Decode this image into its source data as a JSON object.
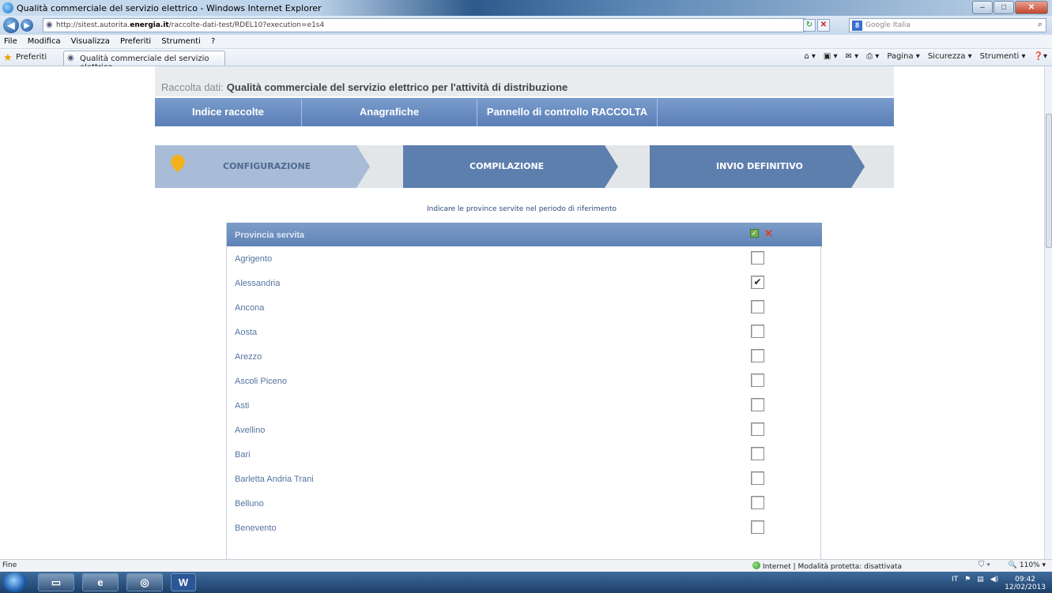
{
  "window": {
    "title": "Qualità commerciale del servizio elettrico - Windows Internet Explorer"
  },
  "address_bar": {
    "url_prefix": "http://sitest.autorita.",
    "url_domain": "energia.it",
    "url_suffix": "/raccolte-dati-test/RDEL10?execution=e1s4",
    "search_placeholder": "Google Italia"
  },
  "menu": [
    "File",
    "Modifica",
    "Visualizza",
    "Preferiti",
    "Strumenti",
    "?"
  ],
  "favorites_bar": {
    "favorites_label": "Preferiti",
    "tab_title": "Qualità commerciale del servizio elettrico",
    "commands": [
      "Pagina ▾",
      "Sicurezza ▾",
      "Strumenti ▾"
    ]
  },
  "page": {
    "header_label": "Raccolta dati",
    "header_value": "Qualità commerciale del servizio elettrico per l'attività di distribuzione",
    "nav": [
      "Indice raccolte",
      "Anagrafiche",
      "Pannello di controllo RACCOLTA"
    ],
    "steps": [
      "CONFIGURAZIONE",
      "COMPILAZIONE",
      "INVIO DEFINITIVO"
    ],
    "instruction": "Indicare le province servite nel periodo di riferimento",
    "table_header": "Provincia servita",
    "provinces": [
      {
        "name": "Agrigento",
        "checked": false
      },
      {
        "name": "Alessandria",
        "checked": true
      },
      {
        "name": "Ancona",
        "checked": false
      },
      {
        "name": "Aosta",
        "checked": false
      },
      {
        "name": "Arezzo",
        "checked": false
      },
      {
        "name": "Ascoli Piceno",
        "checked": false
      },
      {
        "name": "Asti",
        "checked": false
      },
      {
        "name": "Avellino",
        "checked": false
      },
      {
        "name": "Bari",
        "checked": false
      },
      {
        "name": "Barletta Andria Trani",
        "checked": false
      },
      {
        "name": "Belluno",
        "checked": false
      },
      {
        "name": "Benevento",
        "checked": false
      }
    ]
  },
  "status_bar": {
    "left": "Fine",
    "zone": "Internet | Modalità protetta: disattivata",
    "zoom": "110%"
  },
  "taskbar": {
    "lang": "IT",
    "time": "09:42",
    "date": "12/02/2013"
  }
}
